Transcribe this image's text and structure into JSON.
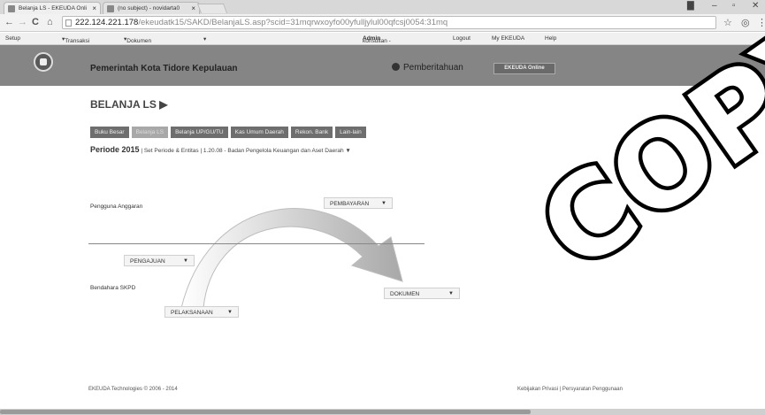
{
  "browser": {
    "tabs": [
      {
        "title": "Belanja LS - EKEUDA Onli"
      },
      {
        "title": "(no subject) - novidarta0"
      }
    ],
    "url_host": "222.124.221.178",
    "url_path": "/ekeudatk15/SAKD/BelanjaLS.asp?scid=31mqrwxoyfo00yfulljylul00qfcsj0054:31mq"
  },
  "menubar": {
    "setup": "Setup",
    "transaksi": "Transaksi",
    "dokumen": "Dokumen",
    "user_prefix": "konsultan - ",
    "user": "Admin",
    "logout": "Logout",
    "my_ekeuda": "My EKEUDA",
    "help": "Help"
  },
  "header": {
    "title": "Pemerintah Kota Tidore Kepulauan",
    "notifications": "Pemberitahuan",
    "badge": "EKEUDA Online"
  },
  "page": {
    "title": "BELANJA LS ▶",
    "tabs": [
      "Buku Besar",
      "Belanja LS",
      "Belanja UP/GU/TU",
      "Kas Umum Daerah",
      "Rekon. Bank",
      "Lain-lain"
    ],
    "periode_label": "Periode 2015",
    "periode_rest": " | Set Periode & Entitas | 1.20.08 - Badan Pengelola Keuangan dan Aset Daerah ▼"
  },
  "flow": {
    "pengguna_anggaran": "Pengguna Anggaran",
    "bendahara": "Bendahara SKPD",
    "pembayaran": "PEMBAYARAN",
    "pengajuan": "PENGAJUAN",
    "pelaksanaan": "PELAKSANAAN",
    "dokumen": "DOKUMEN"
  },
  "footer": {
    "copyright": "EKEUDA Technologies © 2006 - 2014",
    "links": "Kebijakan Privasi | Persyaratan Penggunaan"
  },
  "watermark": "COPY"
}
